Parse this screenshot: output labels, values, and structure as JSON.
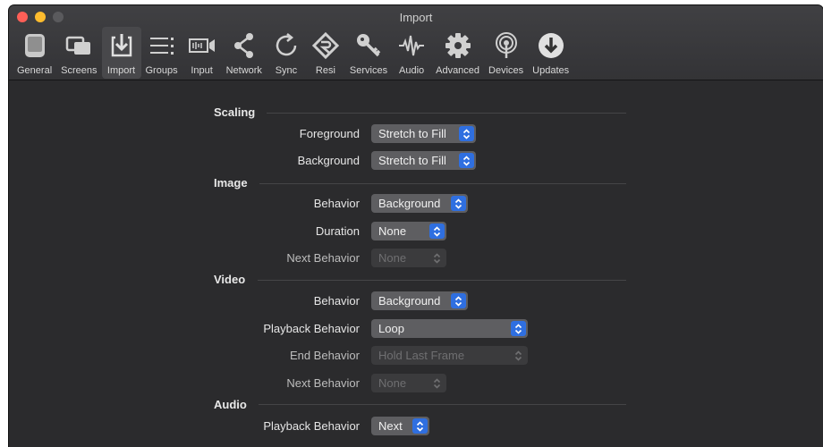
{
  "window": {
    "title": "Import"
  },
  "toolbar": {
    "items": [
      {
        "label": "General",
        "icon": "general-icon"
      },
      {
        "label": "Screens",
        "icon": "screens-icon"
      },
      {
        "label": "Import",
        "icon": "import-icon",
        "active": true
      },
      {
        "label": "Groups",
        "icon": "groups-icon"
      },
      {
        "label": "Input",
        "icon": "input-icon"
      },
      {
        "label": "Network",
        "icon": "network-icon"
      },
      {
        "label": "Sync",
        "icon": "sync-icon"
      },
      {
        "label": "Resi",
        "icon": "resi-icon"
      },
      {
        "label": "Services",
        "icon": "key-icon"
      },
      {
        "label": "Audio",
        "icon": "waveform-icon"
      },
      {
        "label": "Advanced",
        "icon": "gear-icon"
      },
      {
        "label": "Devices",
        "icon": "broadcast-icon"
      },
      {
        "label": "Updates",
        "icon": "download-icon"
      }
    ]
  },
  "scaling": {
    "heading": "Scaling",
    "foreground": {
      "label": "Foreground",
      "value": "Stretch to Fill"
    },
    "background": {
      "label": "Background",
      "value": "Stretch to Fill"
    }
  },
  "image": {
    "heading": "Image",
    "behavior": {
      "label": "Behavior",
      "value": "Background"
    },
    "duration": {
      "label": "Duration",
      "value": "None"
    },
    "next_behavior": {
      "label": "Next Behavior",
      "value": "None",
      "disabled": true
    }
  },
  "video": {
    "heading": "Video",
    "behavior": {
      "label": "Behavior",
      "value": "Background"
    },
    "playback_behavior": {
      "label": "Playback Behavior",
      "value": "Loop"
    },
    "end_behavior": {
      "label": "End Behavior",
      "value": "Hold Last Frame",
      "disabled": true
    },
    "next_behavior": {
      "label": "Next Behavior",
      "value": "None",
      "disabled": true
    }
  },
  "audio": {
    "heading": "Audio",
    "playback_behavior": {
      "label": "Playback Behavior",
      "value": "Next"
    }
  },
  "colors": {
    "accent": "#2f6fe0",
    "window_bg": "#2b2b2d",
    "popup_bg": "#5e5e61"
  }
}
